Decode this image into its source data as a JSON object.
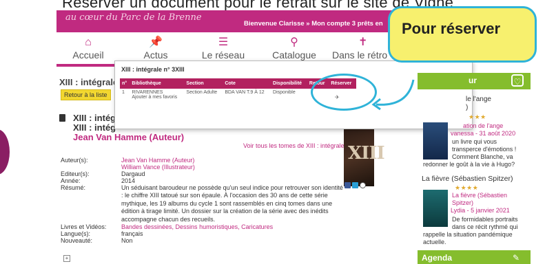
{
  "caption": "Réserver un document pour le retrait sur le site de Vigne",
  "banner": {
    "script_text": "au cœur du Parc de la Brenne",
    "user_text": "Bienvenue Clarisse  » Mon compte  3 prêts en"
  },
  "nav": {
    "items": [
      {
        "label": "Accueil",
        "icon": "house-icon"
      },
      {
        "label": "Actus",
        "icon": "pin-icon"
      },
      {
        "label": "Le réseau",
        "icon": "books-icon"
      },
      {
        "label": "Catalogue",
        "icon": "search-icon"
      },
      {
        "label": "Dans le rétro",
        "icon": "figure-icon"
      }
    ]
  },
  "callout": {
    "text": "Pour réserver"
  },
  "popup": {
    "title": "XIII : intégrale n° 3XIII",
    "headers": [
      "n°",
      "Bibliothèque",
      "Section",
      "Cote",
      "Disponibilité",
      "Retour",
      "Réserver"
    ],
    "row": {
      "n": "1",
      "library": "RIVARENNES",
      "add_favorite": "Ajouter à mes favoris",
      "section": "Section Adulte",
      "cote": "BDA VAN T.9 À 12",
      "availability": "Disponible",
      "return": ""
    }
  },
  "main": {
    "page_title": "XIII : intégrale",
    "back_button": "Retour à la liste",
    "subtitle1": "XIII : intég",
    "subtitle2": "XIII : intég",
    "author_title": "Jean Van Hamme (Auteur)",
    "see_all_link": "Voir tous les tomes de XIII : intégrale",
    "fields": [
      {
        "label": "Auteur(s):",
        "values": [
          "Jean Van Hamme (Auteur)",
          "William Vance (Illustrateur)"
        ],
        "link": true
      },
      {
        "label": "Editeur(s):",
        "values": [
          "Dargaud"
        ],
        "link": false
      },
      {
        "label": "Année:",
        "values": [
          "2014"
        ],
        "link": false
      }
    ],
    "resume_label": "Résumé:",
    "resume_text": "Un séduisant baroudeur ne possède qu'un seul indice pour retrouver son identité : le chiffre XIII tatoué sur son épaule. À l'occasion des 30 ans de cette série mythique, les 19 albums du cycle 1 sont rassemblés en cinq tomes dans une édition à tirage limité. Un dossier sur la création de la série avec des inédits accompagne chacun des recueils.",
    "more_fields": [
      {
        "label": "Livres et Vidéos:",
        "value": "Bandes dessinées, Dessins humoristiques, Caricatures",
        "link": true
      },
      {
        "label": "Langue(s):",
        "value": "français",
        "link": false
      },
      {
        "label": "Nouveauté:",
        "value": "Non",
        "link": false
      }
    ],
    "cover_text": "XIII"
  },
  "sidebar": {
    "heading": "ur",
    "entry1": {
      "title_lines": [
        "le l'ange",
        ")"
      ],
      "link_line": "ation de l'ange",
      "author_date": "vanessa - 31 août 2020",
      "review_lines": [
        "un livre qui vous",
        "transperce d'émotions !",
        "Comment Blanche, va",
        "redonner le goût à la vie à Hugo?"
      ]
    },
    "entry2": {
      "title": "La fièvre (Sébastien Spitzer)",
      "link_lines": [
        "La fièvre (Sébastien",
        "Spitzer)"
      ],
      "author_date": "Lydia - 5 janvier 2021",
      "review_lines": [
        "De formidables portraits",
        "dans ce récit rythmé qui",
        "rappelle la situation pandémique",
        "actuelle."
      ]
    },
    "agenda": "Agenda"
  },
  "colors": {
    "brand_magenta": "#c02a80",
    "table_header": "#b2215f",
    "accent_green": "#85bd2d",
    "highlight_blue": "#2fb3d8",
    "callout_yellow": "#f7f06e",
    "button_yellow": "#f2d730"
  }
}
